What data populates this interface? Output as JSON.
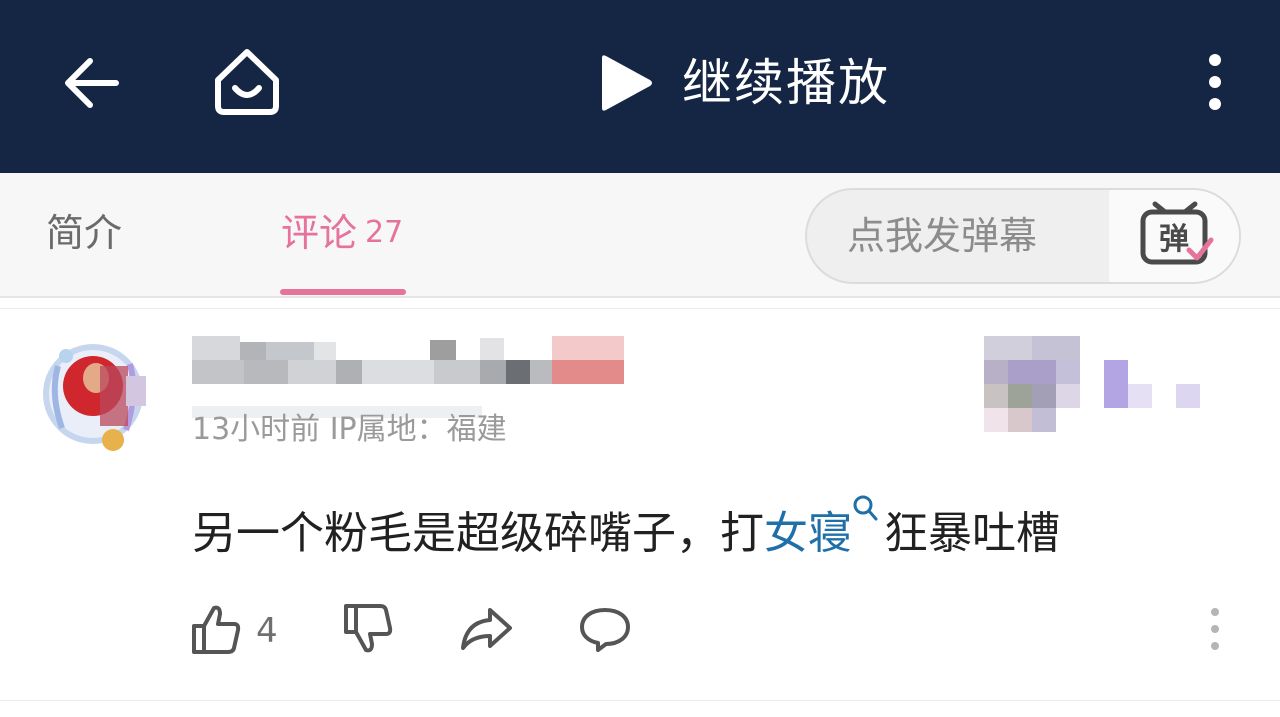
{
  "topbar": {
    "resume_label": "继续播放",
    "icons": [
      "back-arrow-icon",
      "home-icon",
      "play-icon",
      "more-vertical-icon"
    ]
  },
  "tabs": {
    "intro_label": "简介",
    "comments_label": "评论",
    "comments_count": "27",
    "active": "评论"
  },
  "danmaku": {
    "placeholder": "点我发弹幕",
    "toggle_glyph": "弹",
    "toggle_icon": "danmaku-tv-check-icon"
  },
  "comment": {
    "meta": "13小时前 IP属地：福建",
    "text_before": "另一个粉毛是超级碎嘴子，打",
    "keyword": "女寝",
    "text_after": "狂暴吐槽",
    "like_count": "4"
  },
  "colors": {
    "topbar_bg": "#142644",
    "accent_pink": "#e5739c",
    "keyword_blue": "#1f6fa8",
    "tabrow_bg": "#f7f7f8"
  }
}
